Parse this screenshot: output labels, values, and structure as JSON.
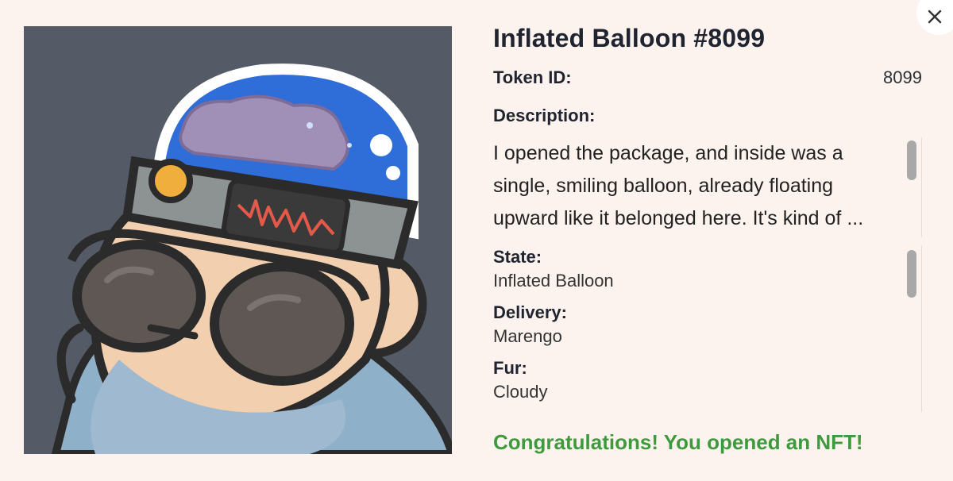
{
  "modal": {
    "title": "Inflated Balloon #8099",
    "token_id_label": "Token ID:",
    "token_id_value": "8099",
    "description_label": "Description:",
    "description_text": "I opened the package, and inside was a single, smiling balloon, already floating upward like it belonged here. It's kind of ...",
    "attributes": [
      {
        "label": "State:",
        "value": "Inflated Balloon"
      },
      {
        "label": "Delivery:",
        "value": "Marengo"
      },
      {
        "label": "Fur:",
        "value": "Cloudy"
      }
    ],
    "congrats_message": "Congratulations! You opened an NFT!",
    "close_icon": "close-icon"
  },
  "colors": {
    "background": "#fcf3ee",
    "art_background": "#545b66",
    "congrats": "#3f9a3e"
  }
}
